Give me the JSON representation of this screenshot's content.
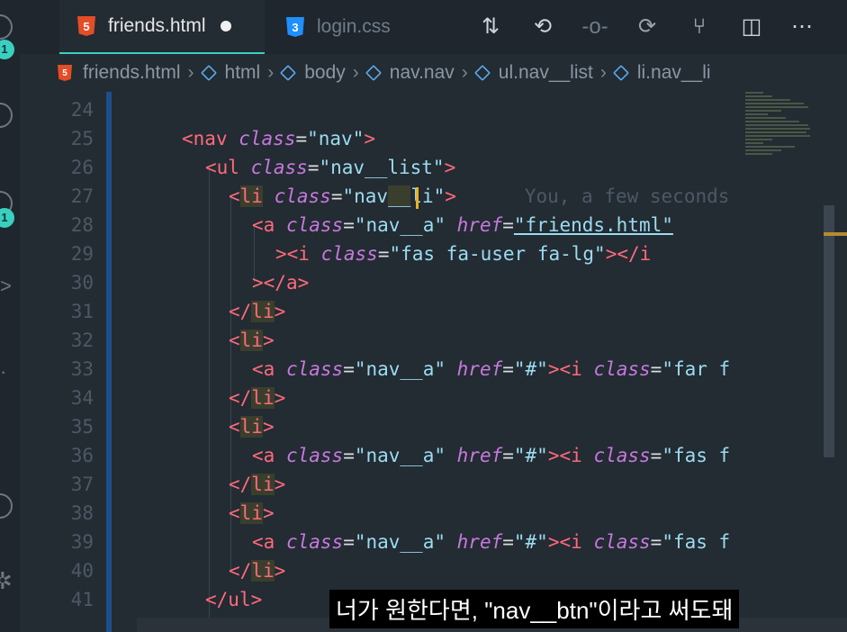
{
  "tabs": [
    {
      "name": "friends.html",
      "active": true,
      "modified": true,
      "icon": "html5-icon"
    },
    {
      "name": "login.css",
      "active": false,
      "modified": false,
      "icon": "css3-icon"
    }
  ],
  "activity_bar": {
    "badge_top": "1",
    "badge_mid": "1"
  },
  "breadcrumb": [
    "friends.html",
    "html",
    "body",
    "nav.nav",
    "ul.nav__list",
    "li.nav__li"
  ],
  "lines": [
    {
      "n": "24"
    },
    {
      "n": "25"
    },
    {
      "n": "26"
    },
    {
      "n": "27",
      "blame": "You, a few seconds"
    },
    {
      "n": "28"
    },
    {
      "n": "29"
    },
    {
      "n": "30"
    },
    {
      "n": "31"
    },
    {
      "n": "32"
    },
    {
      "n": "33"
    },
    {
      "n": "34"
    },
    {
      "n": "35"
    },
    {
      "n": "36"
    },
    {
      "n": "37"
    },
    {
      "n": "38"
    },
    {
      "n": "39"
    },
    {
      "n": "40"
    },
    {
      "n": "41"
    }
  ],
  "code": {
    "nav_tag": "nav",
    "ul_tag": "ul",
    "li_tag": "li",
    "a_tag": "a",
    "i_tag": "i",
    "class_attr": "class",
    "href_attr": "href",
    "nav_class": "\"nav\"",
    "ul_class": "\"nav__list\"",
    "li_class_a": "\"nav",
    "li_class_b": "__",
    "li_class_c": "li\"",
    "a_class": "\"nav__a\"",
    "href_friends": "\"friends.html\"",
    "href_hash": "\"#\"",
    "icon_user": "\"fas fa-user fa-lg\"",
    "far_f": "\"far f",
    "fas_f": "\"fas f",
    "blame": "You, a few seconds"
  },
  "subtitle": "너가 원한다면, \"nav__btn\"이라고 써도돼",
  "colors": {
    "accent": "#3ad0c0",
    "tag": "#ff6a7a",
    "attr": "#c679dd",
    "string": "#9bdcf0"
  }
}
